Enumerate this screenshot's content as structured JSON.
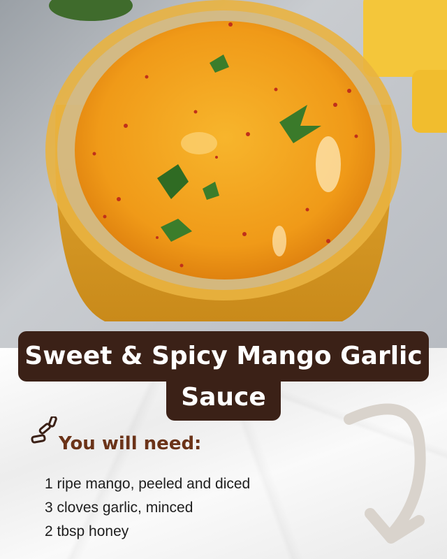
{
  "title": {
    "line1": "Sweet & Spicy Mango Garlic",
    "line2": "Sauce"
  },
  "section_heading": "You will need:",
  "ingredients": [
    "1 ripe mango, peeled and diced",
    "3 cloves garlic, minced",
    "2 tbsp honey"
  ],
  "colors": {
    "title_background": "#3b2117",
    "title_text": "#ffffff",
    "heading_text": "#6b3318",
    "sauce": "#f0a51e"
  },
  "icons": [
    "sparkle-icon",
    "curved-arrow-icon"
  ]
}
